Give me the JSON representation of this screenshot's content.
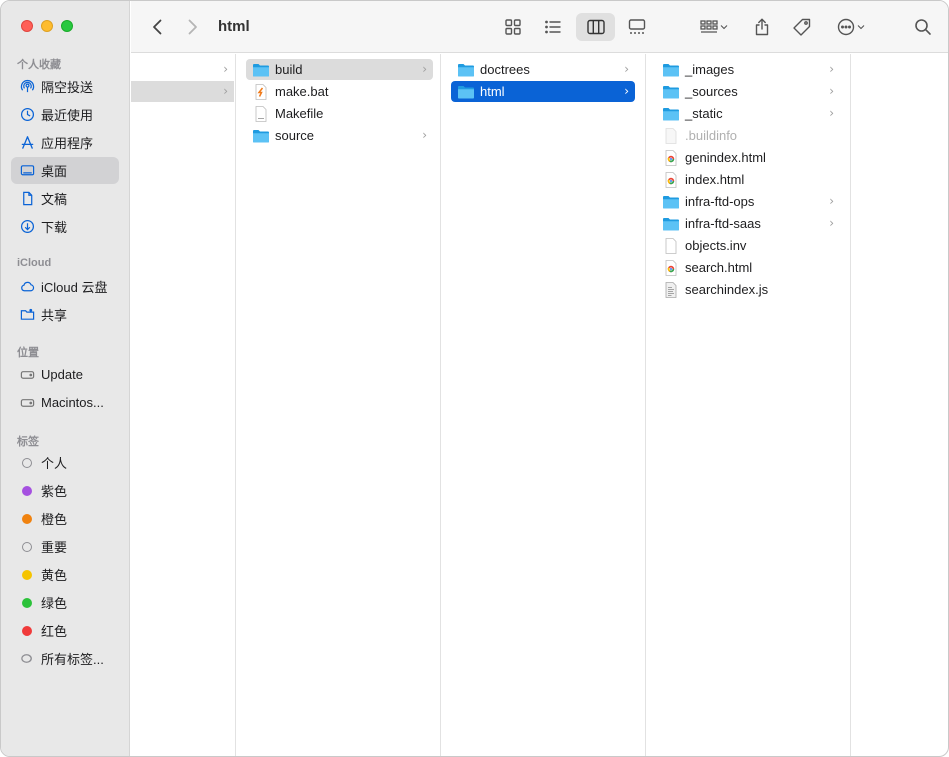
{
  "window": {
    "title": "html"
  },
  "sidebar": {
    "sections": {
      "favorites": "个人收藏",
      "icloud": "iCloud",
      "locations": "位置",
      "tags": "标签"
    },
    "favorites": [
      {
        "label": "隔空投送",
        "icon": "airdrop-icon"
      },
      {
        "label": "最近使用",
        "icon": "clock-icon"
      },
      {
        "label": "应用程序",
        "icon": "applications-icon"
      },
      {
        "label": "桌面",
        "icon": "desktop-icon",
        "selected": true
      },
      {
        "label": "文稿",
        "icon": "document-icon"
      },
      {
        "label": "下载",
        "icon": "download-icon"
      }
    ],
    "icloud": [
      {
        "label": "iCloud 云盘",
        "icon": "cloud-icon"
      },
      {
        "label": "共享",
        "icon": "shared-folder-icon"
      }
    ],
    "locations": [
      {
        "label": "Update",
        "icon": "disk-icon"
      },
      {
        "label": "Macintos...",
        "icon": "disk-icon"
      }
    ],
    "tags": [
      {
        "label": "个人",
        "color": "ring"
      },
      {
        "label": "紫色",
        "color": "#a550e0"
      },
      {
        "label": "橙色",
        "color": "#f0820f"
      },
      {
        "label": "重要",
        "color": "ring"
      },
      {
        "label": "黄色",
        "color": "#f5c400"
      },
      {
        "label": "绿色",
        "color": "#2cc23a"
      },
      {
        "label": "红色",
        "color": "#f03a3a"
      },
      {
        "label": "所有标签...",
        "color": "all"
      }
    ]
  },
  "columns": [
    {
      "items": [
        {
          "name": "",
          "type": "folder",
          "selected": "none",
          "chevron": true
        },
        {
          "name": "",
          "type": "folder",
          "selected": "gray",
          "chevron": true
        }
      ]
    },
    {
      "items": [
        {
          "name": "build",
          "type": "folder",
          "selected": "gray",
          "chevron": true
        },
        {
          "name": "make.bat",
          "type": "bat",
          "selected": "none",
          "chevron": false
        },
        {
          "name": "Makefile",
          "type": "file",
          "selected": "none",
          "chevron": false
        },
        {
          "name": "source",
          "type": "folder",
          "selected": "none",
          "chevron": true
        }
      ]
    },
    {
      "items": [
        {
          "name": "doctrees",
          "type": "folder",
          "selected": "none",
          "chevron": true
        },
        {
          "name": "html",
          "type": "folder",
          "selected": "blue",
          "chevron": true
        }
      ]
    },
    {
      "items": [
        {
          "name": "_images",
          "type": "folder",
          "selected": "none",
          "chevron": true
        },
        {
          "name": "_sources",
          "type": "folder",
          "selected": "none",
          "chevron": true
        },
        {
          "name": "_static",
          "type": "folder",
          "selected": "none",
          "chevron": true
        },
        {
          "name": ".buildinfo",
          "type": "file-dim",
          "selected": "none",
          "chevron": false
        },
        {
          "name": "genindex.html",
          "type": "html",
          "selected": "none",
          "chevron": false
        },
        {
          "name": "index.html",
          "type": "html",
          "selected": "none",
          "chevron": false
        },
        {
          "name": "infra-ftd-ops",
          "type": "folder",
          "selected": "none",
          "chevron": true
        },
        {
          "name": "infra-ftd-saas",
          "type": "folder",
          "selected": "none",
          "chevron": true
        },
        {
          "name": "objects.inv",
          "type": "file",
          "selected": "none",
          "chevron": false
        },
        {
          "name": "search.html",
          "type": "html",
          "selected": "none",
          "chevron": false
        },
        {
          "name": "searchindex.js",
          "type": "js",
          "selected": "none",
          "chevron": false
        }
      ]
    }
  ]
}
